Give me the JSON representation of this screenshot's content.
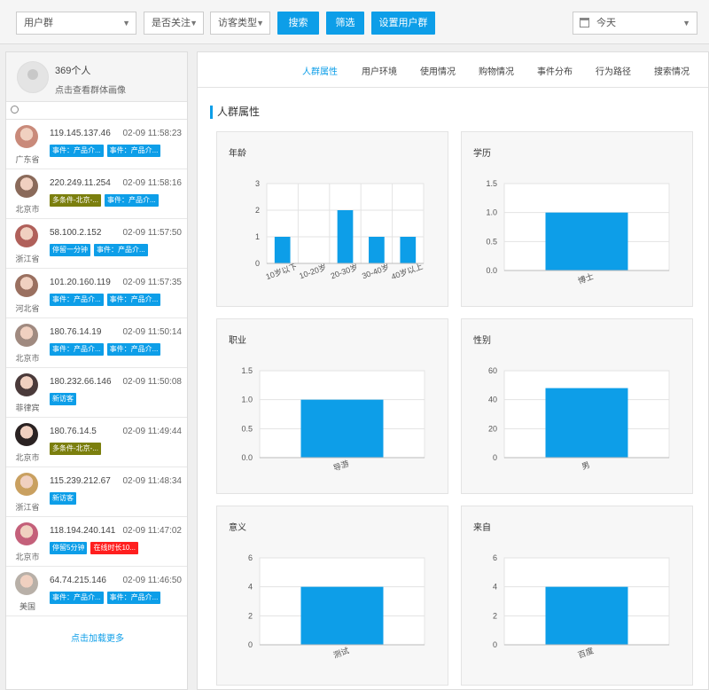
{
  "toolbar": {
    "user_group": "用户群",
    "follow": "是否关注",
    "visitor_type": "访客类型",
    "search_label": "搜索",
    "filter_label": "筛选",
    "set_group_label": "设置用户群",
    "date": "今天"
  },
  "sidebar": {
    "count": "369个人",
    "portrait_link": "点击查看群体画像",
    "load_more": "点击加载更多",
    "visitors": [
      {
        "region": "广东省",
        "ip": "119.145.137.46",
        "time": "02-09 11:58:23",
        "tags": [
          {
            "text": "事件：产品介...",
            "color": "#0d9ee8"
          },
          {
            "text": "事件：产品介...",
            "color": "#0d9ee8"
          }
        ]
      },
      {
        "region": "北京市",
        "ip": "220.249.11.254",
        "time": "02-09 11:58:16",
        "tags": [
          {
            "text": "多条件-北京-...",
            "color": "#7b7f0e"
          },
          {
            "text": "事件：产品介...",
            "color": "#0d9ee8"
          }
        ]
      },
      {
        "region": "浙江省",
        "ip": "58.100.2.152",
        "time": "02-09 11:57:50",
        "tags": [
          {
            "text": "停留一分钟",
            "color": "#0d9ee8"
          },
          {
            "text": "事件：产品介...",
            "color": "#0d9ee8"
          }
        ]
      },
      {
        "region": "河北省",
        "ip": "101.20.160.119",
        "time": "02-09 11:57:35",
        "tags": [
          {
            "text": "事件：产品介...",
            "color": "#0d9ee8"
          },
          {
            "text": "事件：产品介...",
            "color": "#0d9ee8"
          }
        ]
      },
      {
        "region": "北京市",
        "ip": "180.76.14.19",
        "time": "02-09 11:50:14",
        "tags": [
          {
            "text": "事件：产品介...",
            "color": "#0d9ee8"
          },
          {
            "text": "事件：产品介...",
            "color": "#0d9ee8"
          }
        ]
      },
      {
        "region": "菲律宾",
        "ip": "180.232.66.146",
        "time": "02-09 11:50:08",
        "tags": [
          {
            "text": "新访客",
            "color": "#0d9ee8"
          }
        ]
      },
      {
        "region": "北京市",
        "ip": "180.76.14.5",
        "time": "02-09 11:49:44",
        "tags": [
          {
            "text": "多条件-北京-...",
            "color": "#7b7f0e"
          }
        ]
      },
      {
        "region": "浙江省",
        "ip": "115.239.212.67",
        "time": "02-09 11:48:34",
        "tags": [
          {
            "text": "新访客",
            "color": "#0d9ee8"
          }
        ]
      },
      {
        "region": "北京市",
        "ip": "118.194.240.141",
        "time": "02-09 11:47:02",
        "tags": [
          {
            "text": "停留5分钟",
            "color": "#0d9ee8"
          },
          {
            "text": "在线时长10...",
            "color": "#ff1f1f"
          }
        ]
      },
      {
        "region": "美国",
        "ip": "64.74.215.146",
        "time": "02-09 11:46:50",
        "tags": [
          {
            "text": "事件：产品介...",
            "color": "#0d9ee8"
          },
          {
            "text": "事件：产品介...",
            "color": "#0d9ee8"
          }
        ]
      }
    ]
  },
  "tabs": [
    "人群属性",
    "用户环境",
    "使用情况",
    "购物情况",
    "事件分布",
    "行为路径",
    "搜索情况"
  ],
  "section_title": "人群属性",
  "colors": {
    "accent": "#0d9ee8",
    "olive": "#7b7f0e",
    "red": "#ff1f1f"
  },
  "chart_data": [
    {
      "title": "年龄",
      "type": "bar",
      "categories": [
        "10岁以下",
        "10-20岁",
        "20-30岁",
        "30-40岁",
        "40岁以上"
      ],
      "values": [
        1,
        0,
        2,
        1,
        1
      ],
      "ylim": [
        0,
        3
      ],
      "ticks": [
        0,
        1,
        2,
        3
      ],
      "grid": true
    },
    {
      "title": "学历",
      "type": "bar",
      "categories": [
        "博士"
      ],
      "values": [
        1
      ],
      "ylim": [
        0,
        1.5
      ],
      "ticks": [
        0.0,
        0.5,
        1.0,
        1.5
      ],
      "grid": true
    },
    {
      "title": "职业",
      "type": "bar",
      "categories": [
        "导游"
      ],
      "values": [
        1
      ],
      "ylim": [
        0,
        1.5
      ],
      "ticks": [
        0.0,
        0.5,
        1.0,
        1.5
      ],
      "grid": true
    },
    {
      "title": "性别",
      "type": "bar",
      "categories": [
        "男"
      ],
      "values": [
        48
      ],
      "ylim": [
        0,
        60
      ],
      "ticks": [
        0,
        20,
        40,
        60
      ],
      "grid": true
    },
    {
      "title": "意义",
      "type": "bar",
      "categories": [
        "测试"
      ],
      "values": [
        4
      ],
      "ylim": [
        0,
        6
      ],
      "ticks": [
        0,
        2,
        4,
        6
      ],
      "grid": true
    },
    {
      "title": "来自",
      "type": "bar",
      "categories": [
        "百度"
      ],
      "values": [
        4
      ],
      "ylim": [
        0,
        6
      ],
      "ticks": [
        0,
        2,
        4,
        6
      ],
      "grid": true
    }
  ]
}
